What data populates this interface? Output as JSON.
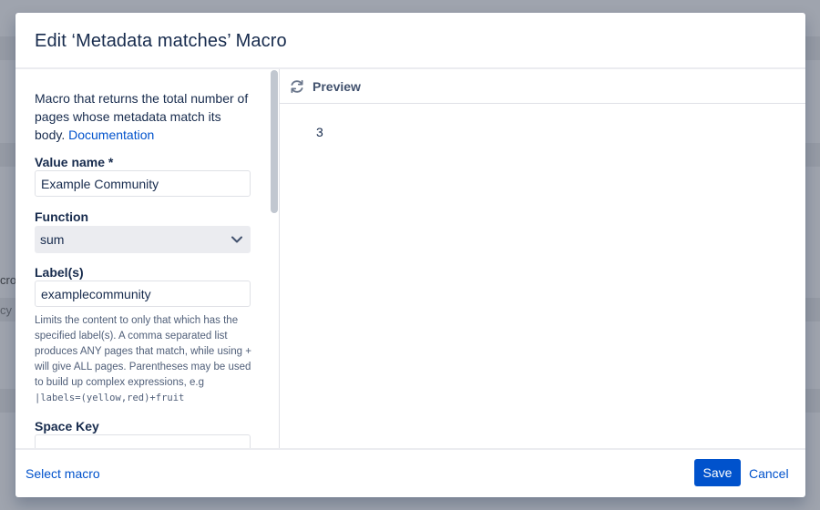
{
  "background": {
    "partial_text_1": "cro",
    "partial_text_2": "cy"
  },
  "dialog": {
    "title": "Edit ‘Metadata matches’ Macro"
  },
  "form": {
    "description": "Macro that returns the total number of pages whose metadata match its body.",
    "documentation_link": "Documentation",
    "value_name": {
      "label": "Value name *",
      "value": "Example Community"
    },
    "function": {
      "label": "Function",
      "selected": "sum"
    },
    "labels": {
      "label": "Label(s)",
      "value": "examplecommunity",
      "help_text": "Limits the content to only that which has the specified label(s). A comma separated list produces ANY pages that match, while using + will give ALL pages. Parentheses may be used to build up complex expressions, e.g",
      "help_code": "|labels=(yellow,red)+fruit"
    },
    "space_key": {
      "label": "Space Key",
      "value": ""
    }
  },
  "preview": {
    "title": "Preview",
    "result": "3"
  },
  "footer": {
    "select_macro_link": "Select macro",
    "save_label": "Save",
    "cancel_label": "Cancel"
  },
  "colors": {
    "primary": "#0052cc",
    "text": "#172b4d",
    "overlay": "#9fa4ae"
  },
  "icons": {
    "refresh": "refresh-icon",
    "dropdown": "chevron-down-icon"
  }
}
